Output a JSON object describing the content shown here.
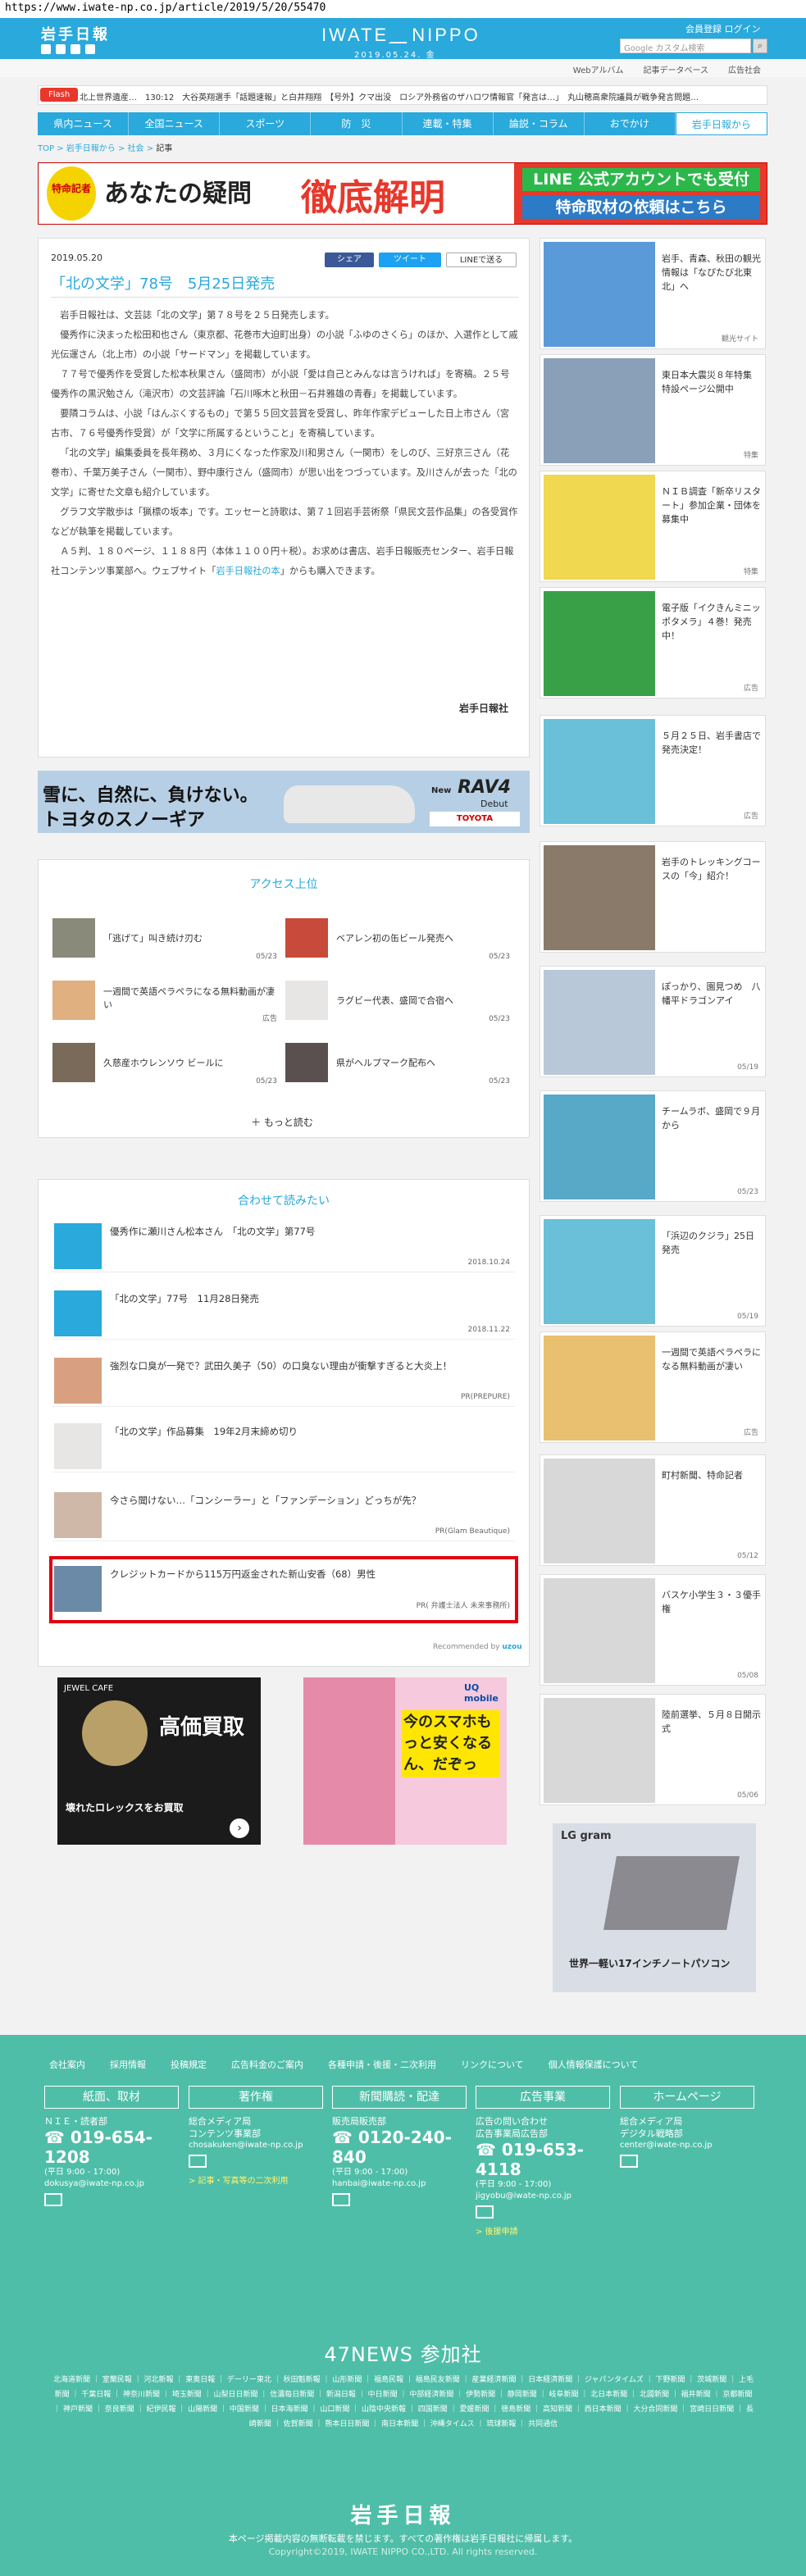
{
  "browser": {
    "url": "https://www.iwate-np.co.jp/article/2019/5/20/55470"
  },
  "header": {
    "logo_jp": "岩手日報",
    "logo_en_left": "IWATE",
    "logo_en_right": "NIPPO",
    "date": "2019.05.24. 金",
    "login": "会員登録 ログイン",
    "search_placeholder": "Google カスタム検索",
    "subnav": [
      "Webアルバム",
      "記事データベース",
      "広告社会"
    ]
  },
  "flash": {
    "label": "Flash",
    "text": "北上世界遺産…　130:12　大谷英翔選手「話題速報」と白井翔翔　【号外】クマ出没　ロシア外務省のザハロワ情報官「発言は…」　丸山穂高衆院議員が戦争発言問題…"
  },
  "mainnav": [
    "県内ニュース",
    "全国ニュース",
    "スポーツ",
    "防　災",
    "連載・特集",
    "論説・コラム",
    "おでかけ",
    "岩手日報から"
  ],
  "breadcrumb": {
    "top": "TOP",
    "c1": "岩手日報から",
    "c2": "社会",
    "current": "記事"
  },
  "banner_top": {
    "medal": "特命記者",
    "mid": "あなたの疑問",
    "big": "徹底解明",
    "r1": "LINE 公式アカウントでも受付",
    "r2": "特命取材の依頼はこちら"
  },
  "article": {
    "date": "2019.05.20",
    "share_fb": "シェア",
    "share_tw": "ツイート",
    "share_line": "LINEで送る",
    "title": "「北の文学」78号　5月25日発売",
    "paragraphs": [
      "岩手日報社は、文芸誌「北の文学」第７８号を２５日発売します。",
      "優秀作に決まった松田和也さん（東京都、花巻市大迫町出身）の小説「ふゆのさくら」のほか、入選作として戚光伝運さん（北上市）の小説「サードマン」を掲載しています。",
      "７７号で優秀作を受賞した松本秋果さん（盛岡市）が小説「愛は自己とみんなは言うければ」を寄稿。２５号優秀作の黒沢勉さん（滝沢市）の文芸評論「石川啄木と秋田－石井雅雄の青春」を掲載しています。",
      "要隣コラムは、小説「はんぶくするもの」で第５５回文芸賞を受賞し、昨年作家デビューした日上市さん（宮古市、７６号優秀作受賞）が「文学に所属するということ」を寄稿しています。",
      "「北の文学」編集委員を長年務め、３月にくなった作家及川和男さん（一関市）をしのび、三好京三さん（花巻市）、千葉万美子さん（一関市）、野中康行さん（盛岡市）が思い出をつづっています。及川さんが去った「北の文学」に寄せた文章も紹介しています。",
      "グラフ文学散歩は「猟標の坂本」です。エッセーと詩歌は、第７１回岩手芸術祭「県民文芸作品集」の各受賞作などが執筆を掲載しています。"
    ],
    "last_para_pre": "Ａ５判、１８０ページ、１１８８円（本体１１００円＋税）。お求めは書店、岩手日報販売センター、岩手日報社コンテンツ事業部へ。ウェブサイト「",
    "last_para_link": "岩手日報社の本",
    "last_para_post": "」からも購入できます。",
    "source": "岩手日報社"
  },
  "ad_toyota": {
    "line1": "雪に、自然に、負けない。",
    "line2": "トヨタのスノーギア",
    "model": "RAV4",
    "model_pre": "New",
    "debut": "Debut",
    "logo": "TOYOTA"
  },
  "access": {
    "title": "アクセス上位",
    "items": [
      {
        "text": "「逃げて」叫き続け刃む",
        "date": "05/23"
      },
      {
        "text": "ベアレン初の缶ビール発売へ",
        "date": "05/23"
      },
      {
        "text": "一週間で英語ペラペラになる無料動画が凄い",
        "date": "広告"
      },
      {
        "text": "ラグビー代表、盛岡で合宿へ",
        "date": "05/23"
      },
      {
        "text": "久慈産ホウレンソウ ビールに",
        "date": "05/23"
      },
      {
        "text": "県がヘルプマーク配布へ",
        "date": "05/23"
      }
    ],
    "more": "もっと読む"
  },
  "related": {
    "title": "合わせて読みたい",
    "items": [
      {
        "text": "優秀作に瀬川さん松本さん　「北の文学」第77号",
        "meta": "2018.10.24"
      },
      {
        "text": "「北の文学」77号　11月28日発売",
        "meta": "2018.11.22"
      },
      {
        "text": "強烈な口臭が一発で？武田久美子（50）の口臭ない理由が衝撃すぎると大炎上！",
        "meta": "PR(PREPURE)"
      },
      {
        "text": "「北の文学」作品募集　19年2月末締め切り",
        "meta": ""
      },
      {
        "text": "今さら聞けない…「コンシーラー」と「ファンデーション」どっちが先？",
        "meta": "PR(Glam Beautique)"
      },
      {
        "text": "クレジットカードから115万円返金された新山安香（68）男性",
        "meta": "PR( 弁護士法人 未来事務所)"
      }
    ],
    "reco_pre": "Recommended by",
    "reco_brand": "uzou"
  },
  "ads_bottom": {
    "jewel_head": "JEWEL CAFE",
    "jewel_big": "高価買取",
    "jewel_sub": "壊れたロレックスをお買取",
    "liq_head": "UQ mobile",
    "liq_big": "今のスマホもっと安くなるん、だぞっ",
    "lg_head": "LG gram",
    "lg_big": "世界一軽い17インチノートパソコン"
  },
  "sidebar": [
    {
      "text": "岩手、青森、秋田の観光情報は「なぴたび北東北」へ",
      "meta": "観光サイト"
    },
    {
      "text": "東日本大震災８年特集　特設ページ公開中",
      "meta": "特集"
    },
    {
      "text": "ＮＩＢ調査「新卒リスタート」参加企業・団体を募集中",
      "meta": "特集"
    },
    {
      "text": "電子版「イクきんミニッポタメラ」４巻！発売中！",
      "meta": "広告"
    },
    {
      "text": "５月２５日、岩手書店で発売決定！",
      "meta": "広告"
    },
    {
      "text": "岩手のトレッキングコースの「今」紹介！",
      "meta": ""
    },
    {
      "text": "ぽっかり、園見つめ　八幡平ドラゴンアイ",
      "meta": "05/19"
    },
    {
      "text": "チームラボ、盛岡で９月から",
      "meta": "05/23"
    },
    {
      "text": "「浜辺のクジラ」25日発売",
      "meta": "05/19"
    },
    {
      "text": "一週間で英語ペラペラになる無料動画が凄い",
      "meta": "広告"
    },
    {
      "text": "町村新聞、特命記者",
      "meta": "05/12"
    },
    {
      "text": "バスケ小学生３・３優手権",
      "meta": "05/08"
    },
    {
      "text": "陸前選挙、５月８日開示式",
      "meta": "05/06"
    }
  ],
  "footer": {
    "links": [
      "会社案内",
      "採用情報",
      "投稿規定",
      "広告料金のご案内",
      "各種申請・後援・二次利用",
      "リンクについて",
      "個人情報保護について"
    ],
    "cols": [
      {
        "head": "紙面、取材",
        "l1": "ＮＩＥ・読者部",
        "tel": "019-654-1208",
        "sm": "(平日 9:00 - 17:00)",
        "mail": "dokusya@iwate-np.co.jp",
        "extra": ""
      },
      {
        "head": "著作権",
        "l1": "総合メディア局\nコンテンツ事業部",
        "tel": "",
        "sm": "",
        "mail": "chosakuken@iwate-np.co.jp",
        "extra": "> 記事・写真等の二次利用"
      },
      {
        "head": "新聞購読・配達",
        "l1": "販売局販売部",
        "tel": "0120-240-840",
        "sm": "(平日 9:00 - 17:00)",
        "mail": "hanbai@iwate-np.co.jp",
        "extra": ""
      },
      {
        "head": "広告事業",
        "l1": "広告の問い合わせ\n広告事業局広告部",
        "tel": "019-653-4118",
        "sm": "(平日 9:00 - 17:00)",
        "mail": "jigyobu@iwate-np.co.jp",
        "extra": "> 後援申請"
      },
      {
        "head": "ホームページ",
        "l1": "総合メディア局\nデジタル戦略部",
        "tel": "",
        "sm": "",
        "mail": "center@iwate-np.co.jp",
        "extra": ""
      }
    ],
    "news47_title": "47NEWS 参加社",
    "news47_list": "北海道新聞 ｜ 室蘭民報 ｜ 河北新報 ｜ 東奥日報 ｜ デーリー東北 ｜ 秋田魁新報 ｜ 山形新聞 ｜ 福島民報 ｜ 福島民友新聞 ｜ 産業経済新聞 ｜ 日本経済新聞 ｜ ジャパンタイムズ ｜ 下野新聞 ｜ 茨城新聞 ｜ 上毛新聞 ｜ 千葉日報 ｜ 神奈川新聞 ｜ 埼玉新聞 ｜ 山梨日日新聞 ｜ 信濃毎日新聞 ｜ 新潟日報 ｜ 中日新聞 ｜ 中部経済新聞 ｜ 伊勢新聞 ｜ 静岡新聞 ｜ 岐阜新聞 ｜ 北日本新聞 ｜ 北國新聞 ｜ 福井新聞 ｜ 京都新聞 ｜ 神戸新聞 ｜ 奈良新聞 ｜ 紀伊民報 ｜ 山陽新聞 ｜ 中国新聞 ｜ 日本海新聞 ｜ 山口新聞 ｜ 山陰中央新報 ｜ 四国新聞 ｜ 愛媛新聞 ｜ 徳島新聞 ｜ 高知新聞 ｜ 西日本新聞 ｜ 大分合同新聞 ｜ 宮崎日日新聞 ｜ 長崎新聞 ｜ 佐賀新聞 ｜ 熊本日日新聞 ｜ 南日本新聞 ｜ 沖縄タイムス ｜ 琉球新報 ｜ 共同通信",
    "logo": "岩手日報",
    "note": "本ページ掲載内容の無断転載を禁じます。すべての著作権は岩手日報社に帰属します。",
    "copyright": "Copyright©2019, IWATE NIPPO CO.,LTD. All rights reserved."
  }
}
